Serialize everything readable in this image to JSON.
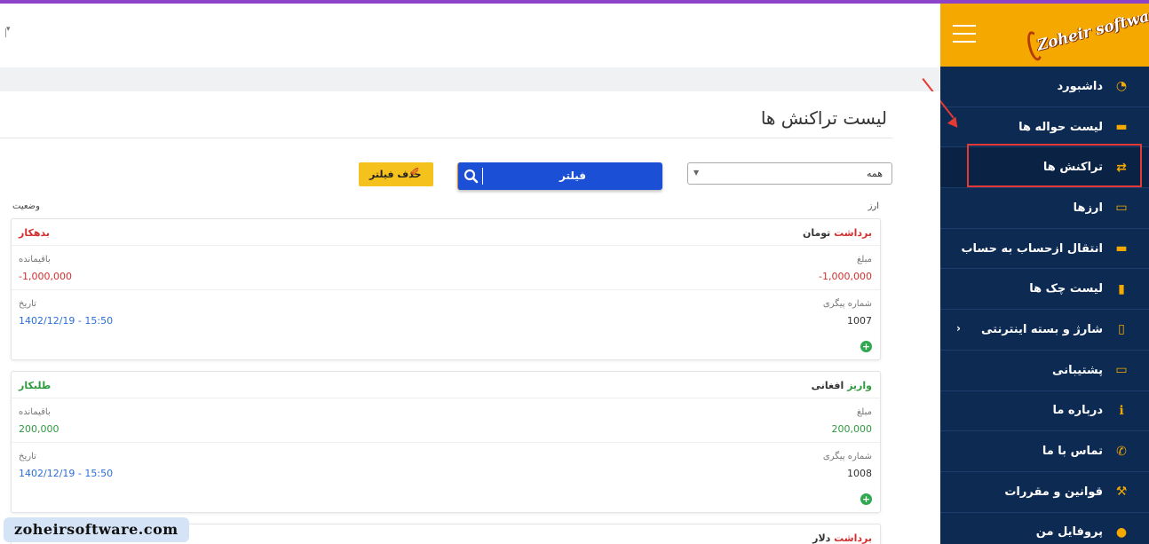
{
  "header": {},
  "sidebar": {
    "logo_text": "Zoheir software",
    "items": [
      {
        "label": "داشبورد",
        "icon": "dashboard-icon",
        "glyph": "◔"
      },
      {
        "label": "لیست حواله ها",
        "icon": "card-icon",
        "glyph": "▬"
      },
      {
        "label": "تراکنش ها",
        "icon": "exchange-icon",
        "glyph": "⇄"
      },
      {
        "label": "ارزها",
        "icon": "money-icon",
        "glyph": "▭"
      },
      {
        "label": "انتقال ازحساب به حساب",
        "icon": "card-icon",
        "glyph": "▬"
      },
      {
        "label": "لیست چک ها",
        "icon": "file-icon",
        "glyph": "▮"
      },
      {
        "label": "شارژ و بسته اینترنتی",
        "icon": "mobile-icon",
        "glyph": "▯"
      },
      {
        "label": "پشتیبانی",
        "icon": "ticket-icon",
        "glyph": "▭"
      },
      {
        "label": "درباره ما",
        "icon": "info-icon",
        "glyph": "ℹ"
      },
      {
        "label": "تماس با ما",
        "icon": "phone-icon",
        "glyph": "✆"
      },
      {
        "label": "قوانین و مقررات",
        "icon": "gavel-icon",
        "glyph": "⚒"
      },
      {
        "label": "پروفایل من",
        "icon": "user-icon",
        "glyph": "●"
      }
    ],
    "submenu_chevron": "›"
  },
  "main": {
    "title": "لیست تراکنش ها",
    "select_value": "همه",
    "filter_label": "فیلتر",
    "remove_filter_label": "حذف فیلتر",
    "col_currency": "ارز",
    "col_status": "وضعیت"
  },
  "transactions": [
    {
      "kind": "برداشت",
      "currency": "تومان",
      "status": "بدهکار",
      "amount_label": "مبلغ",
      "amount": "-1,000,000",
      "remaining_label": "باقیمانده",
      "remaining": "-1,000,000",
      "tracking_label": "شماره پیگری",
      "tracking": "1007",
      "date_label": "تاریخ",
      "date": "1402/12/19 - 15:50"
    },
    {
      "kind": "واریز",
      "currency": "افغانی",
      "status": "طلبکار",
      "amount_label": "مبلغ",
      "amount": "200,000",
      "remaining_label": "باقیمانده",
      "remaining": "200,000",
      "tracking_label": "شماره پیگری",
      "tracking": "1008",
      "date_label": "تاریخ",
      "date": "1402/12/19 - 15:50"
    },
    {
      "kind": "برداشت",
      "currency": "دلار"
    }
  ],
  "watermark": "zoheirsoftware.com",
  "colors": {
    "accent": "#f5a800",
    "sidebar": "#0d2a52",
    "primary_button": "#1a4fd6",
    "debit": "#d32f2f",
    "credit": "#2e9a3f",
    "highlight": "#e53935"
  }
}
